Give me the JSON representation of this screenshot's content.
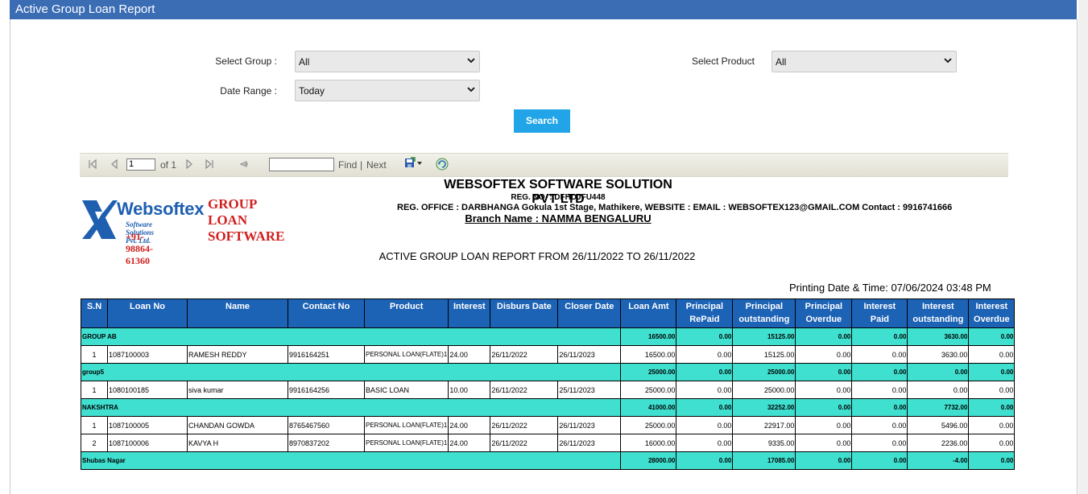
{
  "window": {
    "title": "Active Group Loan Report"
  },
  "filters": {
    "group_label": "Select Group :",
    "group_value": "All",
    "date_label": "Date Range :",
    "date_value": "Today",
    "product_label": "Select Product",
    "product_value": "All",
    "search_label": "Search"
  },
  "toolbar": {
    "page_value": "1",
    "of_text": "of 1",
    "find_label": "Find",
    "separator": "|",
    "next_label": "Next"
  },
  "logo": {
    "brand": "Websoftex",
    "sub": "Software Solutions Pvt. Ltd.",
    "phone": "+91-98864-61360",
    "product_line1": "GROUP",
    "product_line2": "LOAN",
    "product_line3": "SOFTWARE"
  },
  "company": {
    "name": "WEBSOFTEX SOFTWARE SOLUTION PVT LTD",
    "reg_no": "REG. NO. : DFHDJFU448",
    "address": "REG. OFFICE : DARBHANGA  Gokula 1st Stage, Mathikere, WEBSITE :        EMAIL : WEBSOFTEX123@GMAIL.COM   Contact : 9916741666",
    "branch": "Branch Name : NAMMA BENGALURU"
  },
  "report": {
    "title": "ACTIVE GROUP LOAN REPORT FROM 26/11/2022 TO 26/11/2022",
    "printing_label": "Printing Date & Time:  07/06/2024 03:48 PM"
  },
  "table": {
    "headers": [
      "S.N",
      "Loan No",
      "Name",
      "Contact No",
      "Product",
      "Interest",
      "Disburs Date",
      "Closer Date",
      "Loan Amt",
      "Principal RePaid",
      "Principal outstanding",
      "Principal Overdue",
      "Interest Paid",
      "Interest outstanding",
      "Interest Overdue"
    ],
    "groups": [
      {
        "name": "GROUP AB",
        "totals": [
          "16500.00",
          "0.00",
          "15125.00",
          "0.00",
          "0.00",
          "3630.00",
          "0.00"
        ],
        "rows": [
          [
            "1",
            "1087100003",
            "RAMESH  REDDY",
            "9916164251",
            "PERSONAL LOAN(FLATE)1",
            "24.00",
            "26/11/2022",
            "26/11/2023",
            "16500.00",
            "0.00",
            "15125.00",
            "0.00",
            "0.00",
            "3630.00",
            "0.00"
          ]
        ]
      },
      {
        "name": "group5",
        "totals": [
          "25000.00",
          "0.00",
          "25000.00",
          "0.00",
          "0.00",
          "0.00",
          "0.00"
        ],
        "rows": [
          [
            "1",
            "1080100185",
            "siva kumar",
            "9916164256",
            "BASIC LOAN",
            "10.00",
            "26/11/2022",
            "25/11/2023",
            "25000.00",
            "0.00",
            "25000.00",
            "0.00",
            "0.00",
            "0.00",
            "0.00"
          ]
        ]
      },
      {
        "name": "NAKSHTRA",
        "totals": [
          "41000.00",
          "0.00",
          "32252.00",
          "0.00",
          "0.00",
          "7732.00",
          "0.00"
        ],
        "rows": [
          [
            "1",
            "1087100005",
            "CHANDAN GOWDA",
            "8765467560",
            "PERSONAL LOAN(FLATE)1",
            "24.00",
            "26/11/2022",
            "26/11/2023",
            "25000.00",
            "0.00",
            "22917.00",
            "0.00",
            "0.00",
            "5496.00",
            "0.00"
          ],
          [
            "2",
            "1087100006",
            "KAVYA H",
            "8970837202",
            "PERSONAL LOAN(FLATE)1",
            "24.00",
            "26/11/2022",
            "26/11/2023",
            "16000.00",
            "0.00",
            "9335.00",
            "0.00",
            "0.00",
            "2236.00",
            "0.00"
          ]
        ]
      },
      {
        "name": "Shubas Nagar",
        "totals": [
          "28000.00",
          "0.00",
          "17085.00",
          "0.00",
          "0.00",
          "-4.00",
          "0.00"
        ],
        "rows": []
      }
    ]
  },
  "colors": {
    "titlebar": "#3b6db5",
    "search_button": "#22a5e8",
    "table_header": "#1c62b5",
    "group_row": "#40e0d0",
    "logo_blue": "#1f5fb0",
    "logo_red": "#d01f1f"
  }
}
